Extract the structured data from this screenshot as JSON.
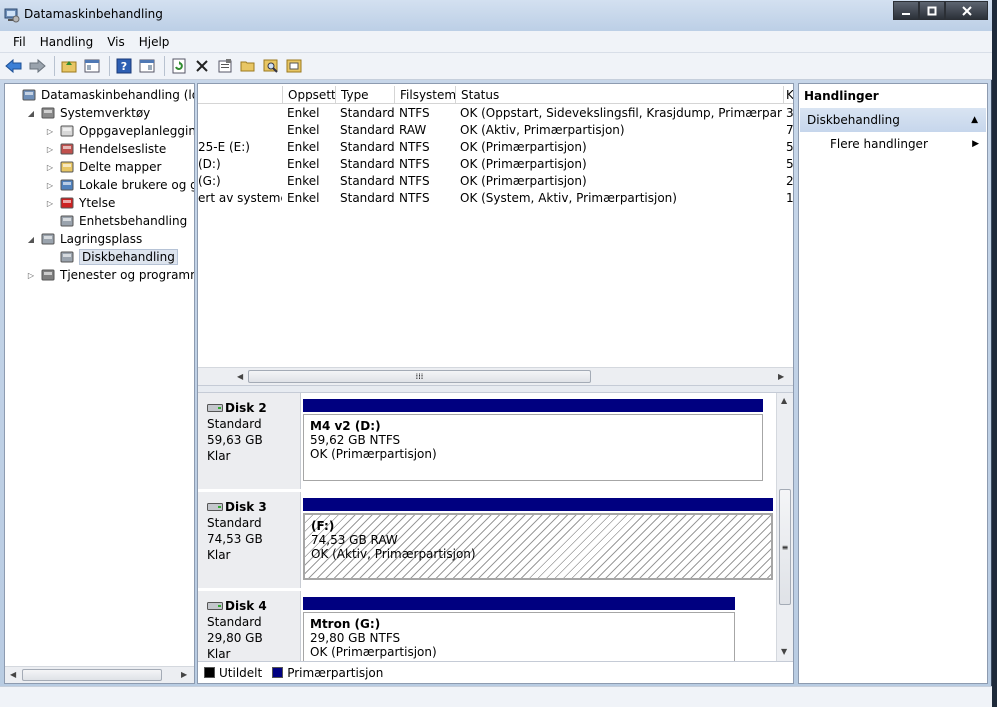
{
  "window": {
    "title": "Datamaskinbehandling"
  },
  "menu": [
    "Fil",
    "Handling",
    "Vis",
    "Hjelp"
  ],
  "tree": [
    {
      "label": "Datamaskinbehandling (lokal)",
      "level": 0,
      "expander": "",
      "icon": "computer-icon"
    },
    {
      "label": "Systemverktøy",
      "level": 1,
      "expander": "◢",
      "icon": "tools-icon"
    },
    {
      "label": "Oppgaveplanlegging",
      "level": 2,
      "expander": "▷",
      "icon": "clock-icon"
    },
    {
      "label": "Hendelsesliste",
      "level": 2,
      "expander": "▷",
      "icon": "event-log-icon"
    },
    {
      "label": "Delte mapper",
      "level": 2,
      "expander": "▷",
      "icon": "shared-folder-icon"
    },
    {
      "label": "Lokale brukere og grupp",
      "level": 2,
      "expander": "▷",
      "icon": "users-icon"
    },
    {
      "label": "Ytelse",
      "level": 2,
      "expander": "▷",
      "icon": "performance-icon"
    },
    {
      "label": "Enhetsbehandling",
      "level": 2,
      "expander": "",
      "icon": "device-manager-icon"
    },
    {
      "label": "Lagringsplass",
      "level": 1,
      "expander": "◢",
      "icon": "storage-icon"
    },
    {
      "label": "Diskbehandling",
      "level": 2,
      "expander": "",
      "icon": "disk-management-icon",
      "selected": true
    },
    {
      "label": "Tjenester og programmer",
      "level": 1,
      "expander": "▷",
      "icon": "services-icon"
    }
  ],
  "list": {
    "columns": [
      "Oppsett",
      "Type",
      "Filsystem",
      "Status",
      "K"
    ],
    "rows": [
      {
        "volume": "",
        "layout": "Enkel",
        "type": "Standard",
        "fs": "NTFS",
        "status": "OK (Oppstart, Sidevekslingsfil, Krasjdump, Primærpartisjon)",
        "cap": "3"
      },
      {
        "volume": "",
        "layout": "Enkel",
        "type": "Standard",
        "fs": "RAW",
        "status": "OK (Aktiv, Primærpartisjon)",
        "cap": "7"
      },
      {
        "volume": "25-E (E:)",
        "layout": "Enkel",
        "type": "Standard",
        "fs": "NTFS",
        "status": "OK (Primærpartisjon)",
        "cap": "5"
      },
      {
        "volume": "(D:)",
        "layout": "Enkel",
        "type": "Standard",
        "fs": "NTFS",
        "status": "OK (Primærpartisjon)",
        "cap": "5"
      },
      {
        "volume": "(G:)",
        "layout": "Enkel",
        "type": "Standard",
        "fs": "NTFS",
        "status": "OK (Primærpartisjon)",
        "cap": "2"
      },
      {
        "volume": "ert av systemet",
        "layout": "Enkel",
        "type": "Standard",
        "fs": "NTFS",
        "status": "OK (System, Aktiv, Primærpartisjon)",
        "cap": "1"
      }
    ]
  },
  "disks": [
    {
      "name": "Disk 2",
      "type": "Standard",
      "size": "59,63 GB",
      "state": "Klar",
      "volume": {
        "name": "M4 v2  (D:)",
        "size": "59,62 GB NTFS",
        "status": "OK (Primærpartisjon)"
      }
    },
    {
      "name": "Disk 3",
      "type": "Standard",
      "size": "74,53 GB",
      "state": "Klar",
      "volume": {
        "name": "(F:)",
        "size": "74,53 GB RAW",
        "status": "OK (Aktiv, Primærpartisjon)"
      }
    },
    {
      "name": "Disk 4",
      "type": "Standard",
      "size": "29,80 GB",
      "state": "Klar",
      "volume": {
        "name": "Mtron  (G:)",
        "size": "29,80 GB NTFS",
        "status": "OK (Primærpartisjon)"
      }
    }
  ],
  "legend": {
    "unallocated": "Utildelt",
    "primary": "Primærpartisjon"
  },
  "actions": {
    "header": "Handlinger",
    "section": "Diskbehandling",
    "more": "Flere handlinger"
  },
  "colors": {
    "primary_partition": "#000080",
    "unallocated": "#000000"
  }
}
